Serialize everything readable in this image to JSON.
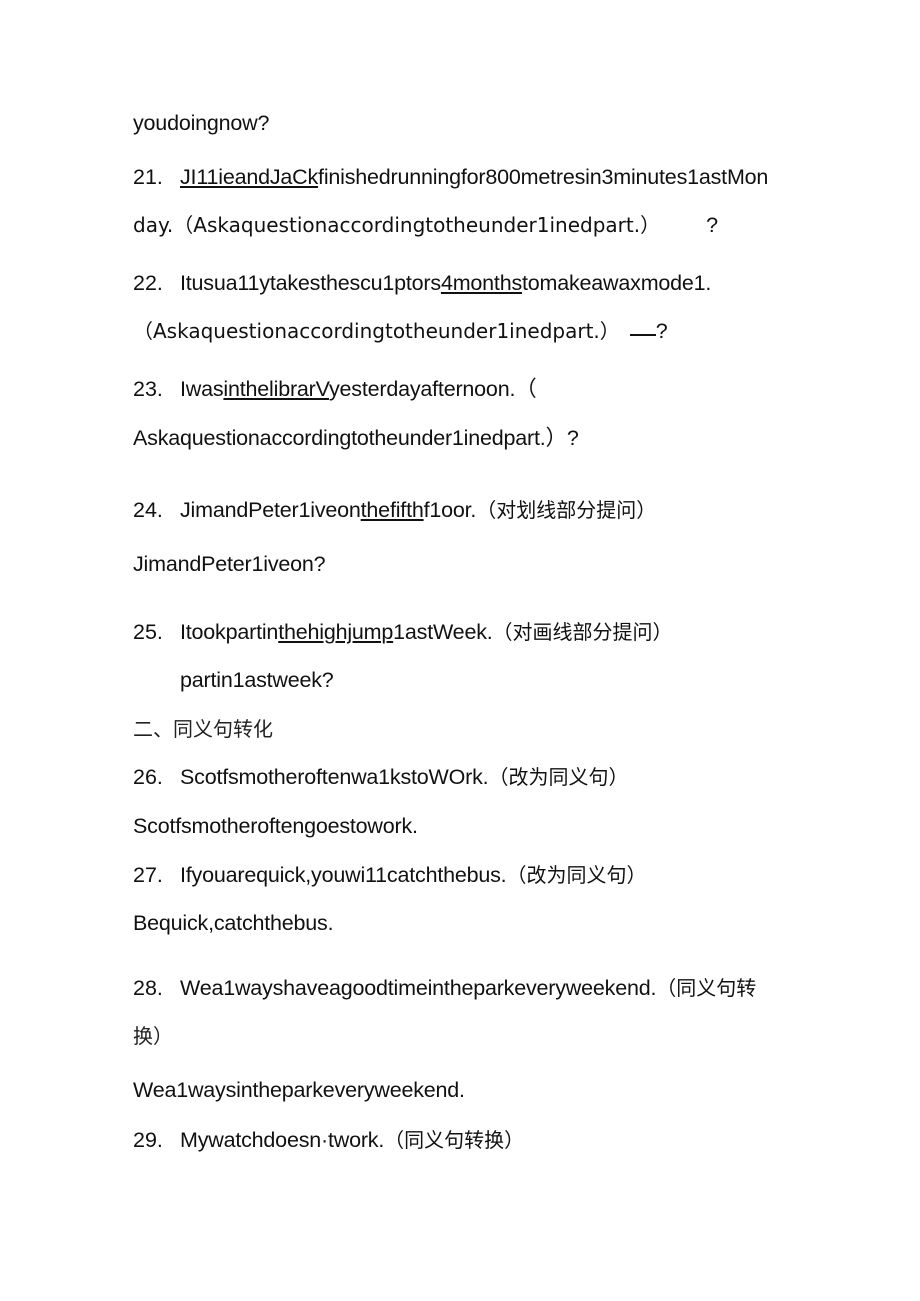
{
  "document": {
    "page_background": "#ffffff",
    "text_color": "#111111"
  },
  "carryover_line": {
    "text": "youdoingnow?"
  },
  "section_heading": {
    "label": "二、同义句转化"
  },
  "items": [
    {
      "number": "21.",
      "line1_underlined": "JI11ieandJaCk",
      "line1_rest": "finishedrunningfor800metresin3minutes1astMon",
      "line2_a": "day.（Askaquestionaccordingtotheunder1inedpart.）",
      "line2_b": "?"
    },
    {
      "number": "22.",
      "line1_pre": "Itusua11ytakesthescu1ptors",
      "line1_underlined": "4months",
      "line1_post": "tomakeawaxmode1.",
      "line2_a": "（Askaquestionaccordingtotheunder1inedpart.）",
      "line2_b": "?"
    },
    {
      "number": "23.",
      "line1_pre": "Iwas",
      "line1_underlined": "inthelibrarV",
      "line1_post": "yesterdayafternoon.（",
      "line2": "Askaquestionaccordingtotheunder1inedpart.）?"
    },
    {
      "number": "24.",
      "line1_pre": "JimandPeter1iveon",
      "line1_underlined": "thefifth",
      "line1_post": "f1oor.",
      "line1_cn": "（对划线部分提问）",
      "line2": "JimandPeter1iveon?"
    },
    {
      "number": "25.",
      "line1_pre": "Itookpartin",
      "line1_underlined": "thehighjump",
      "line1_post": "1astWeek.",
      "line1_cn": "（对画线部分提问）",
      "line2": "partin1astweek?"
    },
    {
      "number": "26.",
      "line1_en": "Scotfsmotheroftenwa1kstoWOrk.",
      "line1_cn": "（改为同义句）",
      "line2": "Scotfsmotheroftengoestowork."
    },
    {
      "number": "27.",
      "line1_en": "Ifyouarequick,youwi11catchthebus.",
      "line1_cn": "（改为同义句）",
      "line2": "Bequick,catchthebus."
    },
    {
      "number": "28.",
      "line1_en": "Wea1wayshaveagoodtimeintheparkeveryweekend.",
      "line1_cn": "（同义句转",
      "line2_cn": "换）",
      "line3": "Wea1waysintheparkeveryweekend."
    },
    {
      "number": "29.",
      "line1_en": "Mywatchdoesn·twork.",
      "line1_cn": "（同义句转换）"
    }
  ]
}
